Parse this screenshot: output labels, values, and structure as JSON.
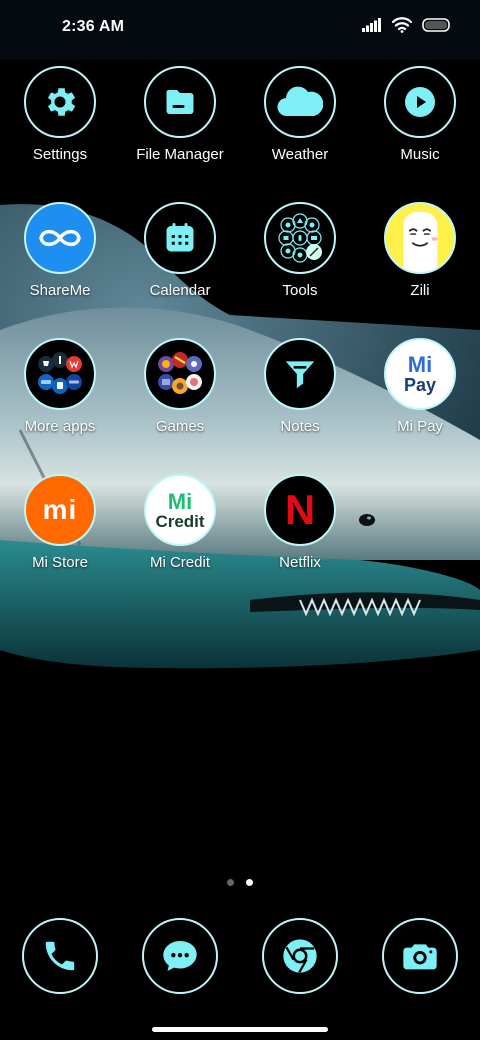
{
  "status_bar": {
    "time": "2:36 AM"
  },
  "apps": [
    [
      {
        "label": "Settings",
        "icon": "gear-icon"
      },
      {
        "label": "File Manager",
        "icon": "folder-icon"
      },
      {
        "label": "Weather",
        "icon": "cloud-icon"
      },
      {
        "label": "Music",
        "icon": "play-icon"
      }
    ],
    [
      {
        "label": "ShareMe",
        "icon": "infinity-icon"
      },
      {
        "label": "Calendar",
        "icon": "calendar-icon"
      },
      {
        "label": "Tools",
        "icon": "tools-folder-icon"
      },
      {
        "label": "Zili",
        "icon": "zili-face-icon"
      }
    ],
    [
      {
        "label": "More apps",
        "icon": "apps-folder-icon"
      },
      {
        "label": "Games",
        "icon": "games-folder-icon"
      },
      {
        "label": "Notes",
        "icon": "funnel-icon"
      },
      {
        "label": "Mi Pay",
        "icon": "mi-pay-icon",
        "text_top": "Mi",
        "text_bottom": "Pay"
      }
    ],
    [
      {
        "label": "Mi Store",
        "icon": "mi-logo-icon",
        "text": "mi"
      },
      {
        "label": "Mi Credit",
        "icon": "mi-credit-icon",
        "text_top": "Mi",
        "text_bottom": "Credit"
      },
      {
        "label": "Netflix",
        "icon": "netflix-icon",
        "text": "N"
      }
    ]
  ],
  "page_indicator": {
    "pages": 2,
    "current": 2
  },
  "dock": [
    {
      "icon": "phone-icon"
    },
    {
      "icon": "message-icon"
    },
    {
      "icon": "chrome-icon"
    },
    {
      "icon": "camera-icon"
    }
  ],
  "colors": {
    "icon_ring": "#bff6f8",
    "accent_cyan": "#7eeff5",
    "shareme_blue": "#1e8ef0",
    "mi_orange": "#ff6900",
    "netflix_red": "#e50914",
    "zili_yellow": "#fff04a",
    "mi_credit_green": "#1dbf73",
    "mi_pay_blue": "#2e6bd6"
  }
}
